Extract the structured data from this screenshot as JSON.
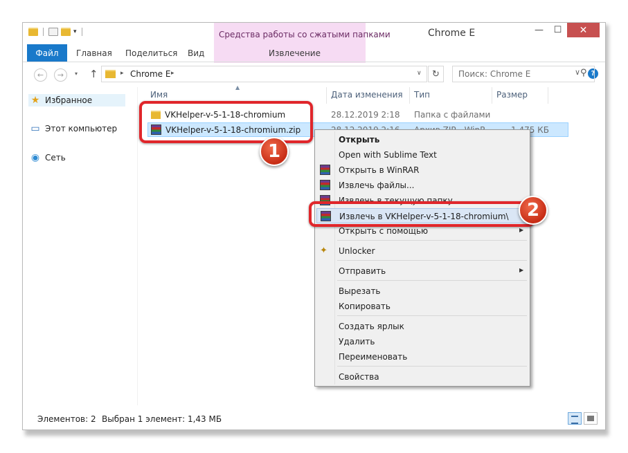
{
  "window": {
    "title": "Chrome E",
    "contextual_tab_group": "Средства работы со сжатыми папками",
    "buttons": {
      "minimize": "—",
      "maximize": "☐",
      "close": "✕"
    }
  },
  "ribbon": {
    "tabs": [
      "Файл",
      "Главная",
      "Поделиться",
      "Вид"
    ],
    "contextual_tab": "Извлечение",
    "help": "?"
  },
  "address_bar": {
    "path": [
      "Chrome E"
    ],
    "search_placeholder": "Поиск: Chrome E"
  },
  "navigation": {
    "items": [
      {
        "label": "Избранное",
        "icon": "star-icon"
      },
      {
        "label": "Этот компьютер",
        "icon": "computer-icon"
      },
      {
        "label": "Сеть",
        "icon": "network-icon"
      }
    ]
  },
  "columns": [
    "Имя",
    "Дата изменения",
    "Тип",
    "Размер"
  ],
  "files": [
    {
      "name": "VKHelper-v-5-1-18-chromium",
      "date": "28.12.2019 2:18",
      "type": "Папка с файлами",
      "size": "",
      "icon": "folder-icon",
      "selected": false
    },
    {
      "name": "VKHelper-v-5-1-18-chromium.zip",
      "date": "28.12.2019 2:16",
      "type": "Архив ZIP - WinR...",
      "size": "1 475 КБ",
      "icon": "winrar-icon",
      "selected": true
    }
  ],
  "context_menu": {
    "items": [
      {
        "label": "Открыть",
        "bold": true
      },
      {
        "label": "Open with Sublime Text"
      },
      {
        "label": "Открыть в WinRAR",
        "icon": "winrar-icon"
      },
      {
        "label": "Извлечь файлы...",
        "icon": "winrar-icon"
      },
      {
        "label": "Извлечь в текущую папку",
        "icon": "winrar-icon"
      },
      {
        "label": "Извлечь в VKHelper-v-5-1-18-chromium\\",
        "icon": "winrar-icon",
        "highlighted": true
      },
      {
        "label": "Открыть с помощью",
        "submenu": true
      },
      {
        "label": "Unlocker",
        "icon": "unlocker-icon"
      },
      {
        "label": "Отправить",
        "submenu": true
      },
      {
        "label": "Вырезать"
      },
      {
        "label": "Копировать"
      },
      {
        "label": "Создать ярлык"
      },
      {
        "label": "Удалить"
      },
      {
        "label": "Переименовать"
      },
      {
        "label": "Свойства"
      }
    ]
  },
  "annotations": {
    "step1": "1",
    "step2": "2",
    "color": "#e0262b"
  },
  "statusbar": {
    "item_count": "Элементов: 2",
    "selection": "Выбран 1 элемент: 1,43 МБ"
  },
  "colors": {
    "accent": "#1979ca",
    "contextual": "#f6dbf3",
    "selection": "#cce8ff"
  }
}
